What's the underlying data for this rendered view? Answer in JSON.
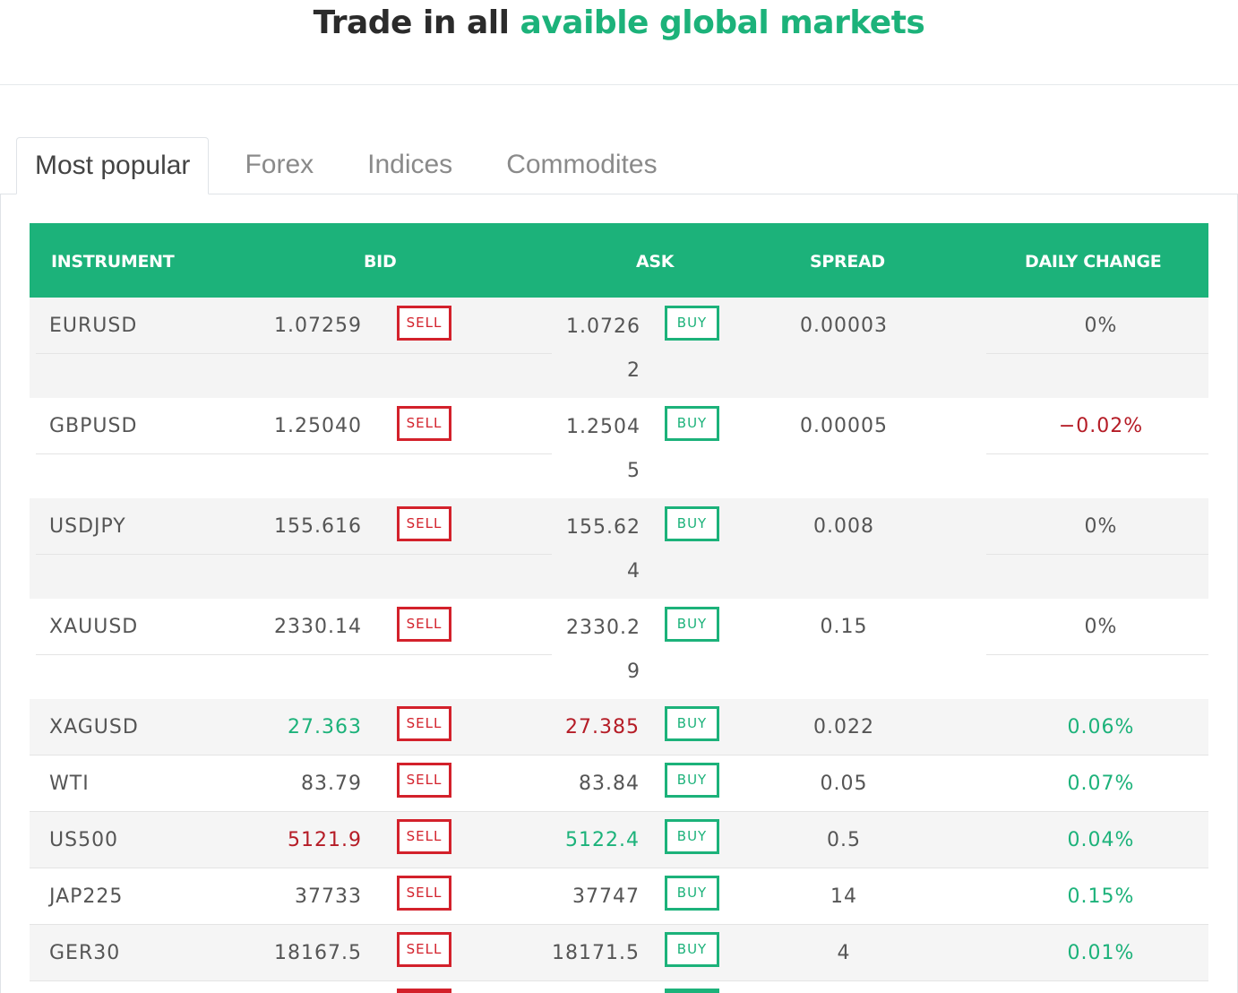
{
  "headline": {
    "prefix": "Trade in all",
    "accent": "avaible global markets"
  },
  "tabs": [
    "Most popular",
    "Forex",
    "Indices",
    "Commodites"
  ],
  "columns": [
    "INSTRUMENT",
    "BID",
    "ASK",
    "SPREAD",
    "DAILY CHANGE"
  ],
  "sell_label": "SELL",
  "buy_label": "BUY",
  "colors": {
    "accent": "#1cb27a",
    "down": "#d3212b"
  },
  "rows": [
    {
      "symbol": "EURUSD",
      "bid": "1.07259",
      "ask_main": "1.0726",
      "ask_wrap": "2",
      "spread": "0.00003",
      "change": "0%"
    },
    {
      "symbol": "GBPUSD",
      "bid": "1.25040",
      "ask_main": "1.2504",
      "ask_wrap": "5",
      "spread": "0.00005",
      "change": "−0.02%"
    },
    {
      "symbol": "USDJPY",
      "bid": "155.616",
      "ask_main": "155.62",
      "ask_wrap": "4",
      "spread": "0.008",
      "change": "0%"
    },
    {
      "symbol": "XAUUSD",
      "bid": "2330.14",
      "ask_main": "2330.2",
      "ask_wrap": "9",
      "spread": "0.15",
      "change": "0%"
    },
    {
      "symbol": "XAGUSD",
      "bid": "27.363",
      "ask": "27.385",
      "spread": "0.022",
      "change": "0.06%"
    },
    {
      "symbol": "WTI",
      "bid": "83.79",
      "ask": "83.84",
      "spread": "0.05",
      "change": "0.07%"
    },
    {
      "symbol": "US500",
      "bid": "5121.9",
      "ask": "5122.4",
      "spread": "0.5",
      "change": "0.04%"
    },
    {
      "symbol": "JAP225",
      "bid": "37733",
      "ask": "37747",
      "spread": "14",
      "change": "0.15%"
    },
    {
      "symbol": "GER30",
      "bid": "18167.5",
      "ask": "18171.5",
      "spread": "4",
      "change": "0.01%"
    }
  ]
}
